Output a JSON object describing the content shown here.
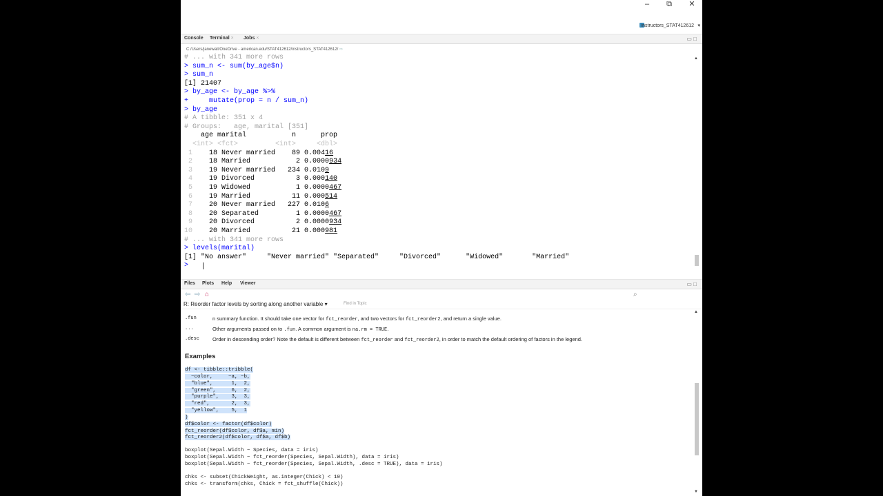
{
  "window": {
    "minimize": "–",
    "restore": "⧉",
    "close": "✕",
    "user": "instructors_STAT412612",
    "user_arrow": "▾"
  },
  "console_pane": {
    "tabs": [
      {
        "label": "Console",
        "close": ""
      },
      {
        "label": "Terminal",
        "close": "×"
      },
      {
        "label": "Jobs",
        "close": "×"
      }
    ],
    "controls": "▭ □",
    "path": "C:/Users/janewall/OneDrive - american.edu/STAT412612/instructors_STAT412612/",
    "path_arrow": "⇨",
    "lines": [
      {
        "parts": [
          {
            "t": "# ... with 341 more rows",
            "c": "cmt"
          }
        ]
      },
      {
        "parts": [
          {
            "t": "> sum_n <- sum(by_age$n)",
            "c": "cmd"
          }
        ]
      },
      {
        "parts": [
          {
            "t": "> sum_n",
            "c": "cmd"
          }
        ]
      },
      {
        "parts": [
          {
            "t": "[1] 21407",
            "c": "out"
          }
        ]
      },
      {
        "parts": [
          {
            "t": "> by_age <- by_age %>%",
            "c": "cmd"
          }
        ]
      },
      {
        "parts": [
          {
            "t": "+     mutate(prop = n / sum_n)",
            "c": "cmd"
          }
        ]
      },
      {
        "parts": [
          {
            "t": "> by_age",
            "c": "cmd"
          }
        ]
      },
      {
        "parts": [
          {
            "t": "# A tibble: 351 x 4",
            "c": "cmt"
          }
        ]
      },
      {
        "parts": [
          {
            "t": "# Groups:   age, marital [351]",
            "c": "cmt"
          }
        ]
      },
      {
        "parts": [
          {
            "t": "    age marital           n      prop",
            "c": "out"
          }
        ]
      },
      {
        "parts": [
          {
            "t": "  <int> <fct>         <int>     <dbl>",
            "c": "dim"
          }
        ]
      },
      {
        "parts": [
          {
            "t": " 1",
            "c": "dim"
          },
          {
            "t": "    18 Never married    89 0.004",
            "c": "out"
          },
          {
            "t": "16",
            "c": "out u"
          }
        ]
      },
      {
        "parts": [
          {
            "t": " 2",
            "c": "dim"
          },
          {
            "t": "    18 Married           2 0.0000",
            "c": "out"
          },
          {
            "t": "934",
            "c": "out u"
          }
        ]
      },
      {
        "parts": [
          {
            "t": " 3",
            "c": "dim"
          },
          {
            "t": "    19 Never married   234 0.010",
            "c": "out"
          },
          {
            "t": "9",
            "c": "out u"
          }
        ]
      },
      {
        "parts": [
          {
            "t": " 4",
            "c": "dim"
          },
          {
            "t": "    19 Divorced          3 0.000",
            "c": "out"
          },
          {
            "t": "140",
            "c": "out u"
          }
        ]
      },
      {
        "parts": [
          {
            "t": " 5",
            "c": "dim"
          },
          {
            "t": "    19 Widowed           1 0.0000",
            "c": "out"
          },
          {
            "t": "467",
            "c": "out u"
          }
        ]
      },
      {
        "parts": [
          {
            "t": " 6",
            "c": "dim"
          },
          {
            "t": "    19 Married          11 0.000",
            "c": "out"
          },
          {
            "t": "514",
            "c": "out u"
          }
        ]
      },
      {
        "parts": [
          {
            "t": " 7",
            "c": "dim"
          },
          {
            "t": "    20 Never married   227 0.010",
            "c": "out"
          },
          {
            "t": "6",
            "c": "out u"
          }
        ]
      },
      {
        "parts": [
          {
            "t": " 8",
            "c": "dim"
          },
          {
            "t": "    20 Separated         1 0.0000",
            "c": "out"
          },
          {
            "t": "467",
            "c": "out u"
          }
        ]
      },
      {
        "parts": [
          {
            "t": " 9",
            "c": "dim"
          },
          {
            "t": "    20 Divorced          2 0.0000",
            "c": "out"
          },
          {
            "t": "934",
            "c": "out u"
          }
        ]
      },
      {
        "parts": [
          {
            "t": "10",
            "c": "dim"
          },
          {
            "t": "    20 Married          21 0.000",
            "c": "out"
          },
          {
            "t": "981",
            "c": "out u"
          }
        ]
      },
      {
        "parts": [
          {
            "t": "# ... with 341 more rows",
            "c": "cmt"
          }
        ]
      },
      {
        "parts": [
          {
            "t": "> levels(marital)",
            "c": "cmd"
          }
        ]
      },
      {
        "parts": [
          {
            "t": "[1] \"No answer\"     \"Never married\" \"Separated\"     \"Divorced\"      \"Widowed\"       \"Married\"",
            "c": "out"
          }
        ]
      },
      {
        "parts": [
          {
            "t": "> ",
            "c": "cmd"
          }
        ]
      }
    ]
  },
  "help_pane": {
    "tabs": [
      {
        "label": "Files",
        "close": ""
      },
      {
        "label": "Plots",
        "close": ""
      },
      {
        "label": "Help",
        "close": ""
      },
      {
        "label": "Viewer",
        "close": ""
      }
    ],
    "controls": "▭ □",
    "nav": {
      "back": "⇦",
      "forward": "⇨",
      "home": "⌂",
      "search": "⌕"
    },
    "title": "R: Reorder factor levels by sorting along another variable",
    "title_arrow": "▾",
    "find_placeholder": "Find in Topic",
    "args": [
      {
        "name": ".fun",
        "desc_a": "n summary function. It should take one vector for ",
        "code_a": "fct_reorder",
        "desc_b": ", and two vectors for ",
        "code_b": "fct_reorder2",
        "desc_c": ", and return a single value.",
        "code_c": "",
        "desc_d": ""
      },
      {
        "name": "...",
        "desc_a": "Other arguments passed on to ",
        "code_a": ".fun",
        "desc_b": ". A common argument is ",
        "code_b": "na.rm = TRUE",
        "desc_c": ".",
        "code_c": "",
        "desc_d": ""
      },
      {
        "name": ".desc",
        "desc_a": "Order in descending order? Note the default is different between ",
        "code_a": "fct_reorder",
        "desc_b": " and ",
        "code_b": "fct_reorder2",
        "desc_c": ", in order to match the default ordering of factors in the legend.",
        "code_c": "",
        "desc_d": ""
      }
    ],
    "examples_heading": "Examples",
    "example_block_1": "df <- tibble::tribble(\n  ~color,     ~a, ~b,\n  \"blue\",      1,  2,\n  \"green\",     6,  2,\n  \"purple\",    3,  3,\n  \"red\",       2,  3,\n  \"yellow\",    5,  1\n)\ndf$color <- factor(df$color)\nfct_reorder(df$color, df$a, min)\nfct_reorder2(df$color, df$a, df$b)",
    "example_block_2": "boxplot(Sepal.Width ~ Species, data = iris)\nboxplot(Sepal.Width ~ fct_reorder(Species, Sepal.Width), data = iris)\nboxplot(Sepal.Width ~ fct_reorder(Species, Sepal.Width, .desc = TRUE), data = iris)",
    "example_block_3": "chks <- subset(ChickWeight, as.integer(Chick) < 10)\nchks <- transform(chks, Chick = fct_shuffle(Chick))"
  },
  "scroll": {
    "up": "▲",
    "down": "▼"
  }
}
